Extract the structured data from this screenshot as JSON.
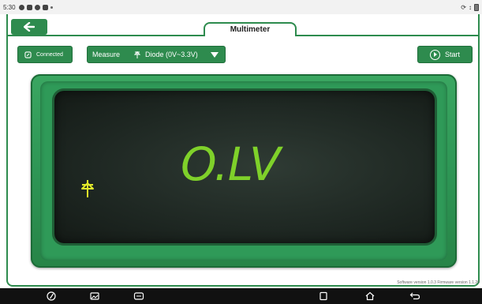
{
  "status_bar": {
    "time": "5:30",
    "right_text": "↕"
  },
  "header": {
    "title": "Multimeter"
  },
  "toolbar": {
    "connected_label": "Connected",
    "measure_label": "Measure",
    "mode_symbol": "⯐",
    "mode_value": "Diode (0V~3.3V)",
    "start_label": "Start"
  },
  "meter": {
    "reading": "O.LV",
    "mode_icon": "diode-icon"
  },
  "footer": {
    "version_text": "Software version 1.0.3  Firmware version 1.1.20"
  },
  "colors": {
    "accent": "#2e8b4e",
    "reading": "#7fd12a",
    "screen": "#1e2722"
  },
  "nav": {
    "icons": [
      "compass-icon",
      "gallery-icon",
      "vci-icon",
      "recent-apps-icon",
      "home-icon",
      "back-icon"
    ]
  }
}
